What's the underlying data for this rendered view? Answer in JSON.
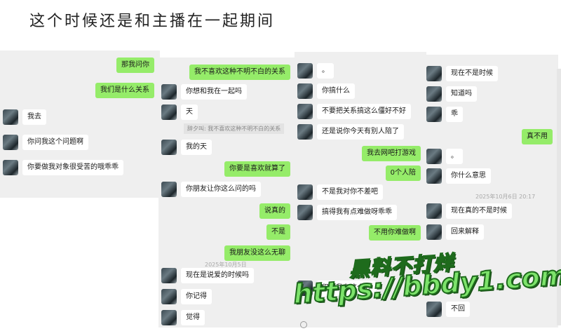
{
  "title": "这个时候还是和主播在一起期间",
  "panel1": {
    "out": [
      "那我问你",
      "我们是什么关系"
    ],
    "in": [
      "我去",
      "你问我这个问题啊",
      "你要做我对象很受苦的哦乖乖"
    ]
  },
  "panel2": {
    "out_top": "我不喜欢这种不明不白的关系",
    "in1": "你想和我在一起吗",
    "in2": "天",
    "recall": "辞夕叫: 我不喜欢这种不明不白的关系",
    "in3": "我的天",
    "out1": "你要是喜欢就算了",
    "in4": "你朋友让你这么问的吗",
    "out2": "说真的",
    "out3": "不是",
    "out4": "我朋友没这么无聊",
    "time": "2025年10月5日",
    "in5": "现在是说爱的时候吗",
    "in6": "你记得",
    "in7": "觉得"
  },
  "panel3": {
    "in1": "。",
    "in2": "你搞什么",
    "in3": "不要把关系搞这么僵好不好",
    "in4": "还是说你今天有别人陪了",
    "out1": "我去网吧打游戏",
    "out2": "0个人陪",
    "in5": "不是我对你不差吧",
    "in6": "搞得我有点难做呀乖乖",
    "out3": "不用你难做啊",
    "in7": "但是我有这个心"
  },
  "panel4": {
    "in1": "现在不是时候",
    "in2": "知道吗",
    "in3": "乖",
    "out1": "真不用",
    "in4": "。",
    "in5": "你什么意思",
    "time": "2025年10月6日 20:17",
    "in6": "现在真的不是时候",
    "in7": "回来解释",
    "in8": "不回"
  },
  "watermark": {
    "line1": "黑料不打烊",
    "line2": "https://bbdy1.com"
  },
  "colors": {
    "outgoing_bubble": "#95ec69",
    "incoming_bubble": "#ffffff",
    "chat_bg": "#efefef",
    "watermark": "#7de36b"
  }
}
